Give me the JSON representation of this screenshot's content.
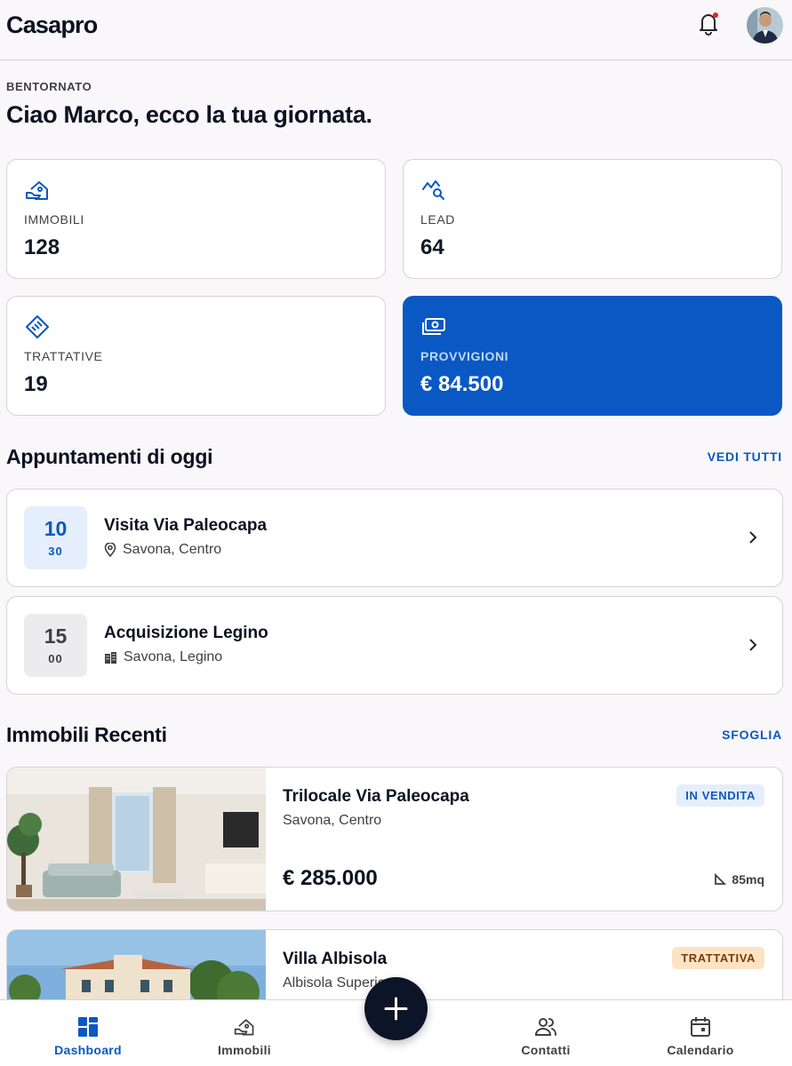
{
  "app": {
    "brand": "Casapro"
  },
  "greeting": {
    "eyebrow": "BENTORNATO",
    "title": "Ciao Marco, ecco la tua giornata."
  },
  "stats": [
    {
      "label": "IMMOBILI",
      "value": "128",
      "icon": "house-key-icon"
    },
    {
      "label": "LEAD",
      "value": "64",
      "icon": "trend-search-icon"
    },
    {
      "label": "TRATTATIVE",
      "value": "19",
      "icon": "handshake-icon"
    },
    {
      "label": "PROVVIGIONI",
      "value": "€ 84.500",
      "icon": "cash-icon"
    }
  ],
  "appointments": {
    "title": "Appuntamenti di oggi",
    "link": "VEDI TUTTI",
    "items": [
      {
        "hour": "10",
        "minute": "30",
        "title": "Visita Via Paleocapa",
        "location": "Savona, Centro",
        "icon": "location-pin-icon"
      },
      {
        "hour": "15",
        "minute": "00",
        "title": "Acquisizione Legino",
        "location": "Savona, Legino",
        "icon": "building-icon"
      }
    ]
  },
  "recent": {
    "title": "Immobili Recenti",
    "link": "SFOGLIA",
    "items": [
      {
        "title": "Trilocale Via Paleocapa",
        "location": "Savona, Centro",
        "price": "€ 285.000",
        "area": "85mq",
        "badge": "IN VENDITA"
      },
      {
        "title": "Villa Albisola",
        "location": "Albisola Superiore",
        "badge": "TRATTATIVA"
      }
    ]
  },
  "nav": {
    "tabs": [
      {
        "label": "Dashboard",
        "icon": "dashboard-grid-icon",
        "active": true
      },
      {
        "label": "Immobili",
        "icon": "house-key-icon"
      },
      {
        "label": "Contatti",
        "icon": "people-icon"
      },
      {
        "label": "Calendario",
        "icon": "calendar-icon"
      }
    ],
    "fab_icon": "plus-icon"
  },
  "colors": {
    "accent": "#0a58c3",
    "dark": "#0b1527",
    "background": "#f9f7f9"
  }
}
